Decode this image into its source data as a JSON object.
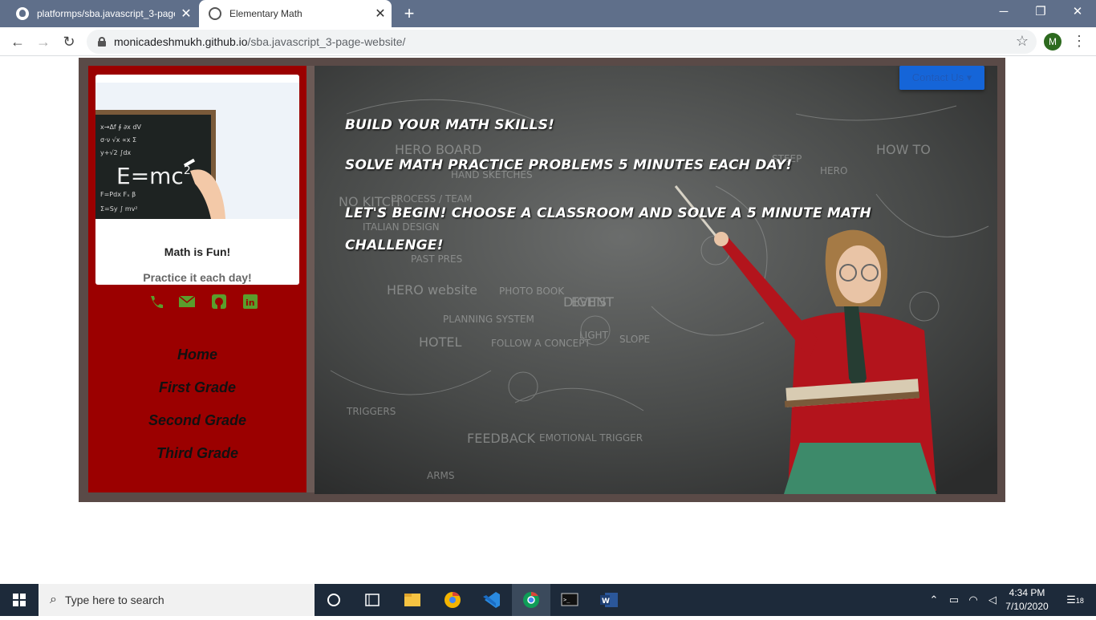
{
  "browser": {
    "tabs": [
      {
        "title": "platformps/sba.javascript_3-page",
        "active": false
      },
      {
        "title": "Elementary Math",
        "active": true
      }
    ],
    "url_host": "monicadeshmukh.github.io",
    "url_path": "/sba.javascript_3-page-website/",
    "profile_initial": "M"
  },
  "sidebar": {
    "card_title": "Math is Fun!",
    "card_subtitle": "Practice it each day!",
    "image_text": "E=mc",
    "image_superscript": "2",
    "social_icons": [
      "phone-icon",
      "envelope-icon",
      "github-icon",
      "linkedin-icon"
    ],
    "social_color": "#5a9e2c",
    "nav": [
      "Home",
      "First Grade",
      "Second Grade",
      "Third Grade"
    ]
  },
  "hero": {
    "lines": [
      "BUILD YOUR MATH SKILLS!",
      "SOLVE MATH PRACTICE PROBLEMS 5 MINUTES EACH DAY!",
      "LET'S BEGIN! CHOOSE A CLASSROOM AND SOLVE A 5 MINUTE MATH",
      "CHALLENGE!"
    ],
    "contact_button": "Contact Us",
    "chalk_words": [
      "HERO BOARD",
      "HAND SKETCHES",
      "PROCESS / TEAM",
      "NO KITCH",
      "ITALIAN DESIGN",
      "PAST PRES",
      "HERO website",
      "PHOTO BOOK",
      "PLANNING SYSTEM",
      "EVENT",
      "LIGHT",
      "SLOPE",
      "HOTEL",
      "FOLLOW A CONCEPT",
      "TRIGGERS",
      "FEEDBACK",
      "EMOTIONAL TRIGGER",
      "ARMS",
      "DIGITS",
      "STEEP",
      "HERO",
      "HOW TO"
    ]
  },
  "colors": {
    "sidebar_bg": "#9b0000",
    "frame_bg": "#5a4a47",
    "button_bg": "#1565d8"
  },
  "taskbar": {
    "search_placeholder": "Type here to search",
    "time": "4:34 PM",
    "date": "7/10/2020",
    "notifications": "18"
  }
}
